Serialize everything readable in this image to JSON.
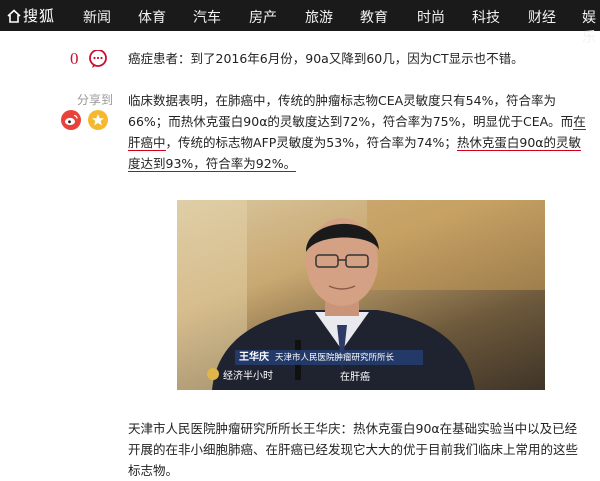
{
  "header": {
    "logo_text": "搜狐",
    "nav": [
      "新闻",
      "体育",
      "汽车",
      "房产",
      "旅游",
      "教育",
      "时尚",
      "科技",
      "财经",
      "娱乐"
    ]
  },
  "social": {
    "comment_count": "0",
    "share_label": "分享到"
  },
  "article": {
    "p1": "癌症患者：到了2016年6月份，90a又降到60几，因为CT显示也不错。",
    "p2_a": "临床数据表明，在肺癌中，传统的肿瘤标志物CEA灵敏度只有54%，符合率为66%；而热休克蛋白90α的灵敏度达到72%，符合率为75%，明显优于CEA。而",
    "p2_b": "在肝癌中",
    "p2_c": "，传统的标志物AFP灵敏度为53%，符合率为74%；",
    "p2_d": "热休克蛋白90α的灵敏度达到93%，符合率为92%。",
    "p3": "天津市人民医院肿瘤研究所所长王华庆：热休克蛋白90α在基础实验当中以及已经开展的在非小细胞肺癌、在肝癌已经发现它大大的优于目前我们临床上常用的这些标志物。"
  },
  "photo": {
    "caption_name": "王华庆",
    "caption_role": "天津市人民医院肿瘤研究所所长",
    "program": "经济半小时",
    "subtitle": "在肝癌"
  },
  "colors": {
    "topbar": "#1a1a1a",
    "accent_red": "#d0021b",
    "caption_blue": "#233c6e"
  }
}
